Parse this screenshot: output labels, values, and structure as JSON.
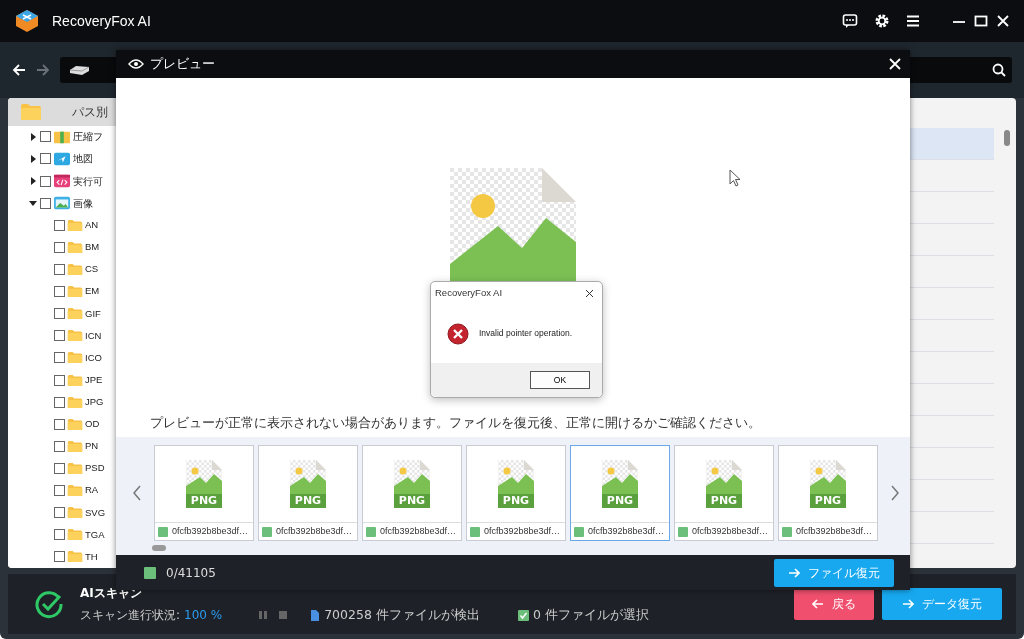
{
  "window": {
    "title": "RecoveryFox AI"
  },
  "sidebar": {
    "header": "パス別",
    "tree": [
      {
        "label": "圧縮フ",
        "kind": "archive",
        "expanded": false,
        "checked": false
      },
      {
        "label": "地図",
        "kind": "map",
        "expanded": false,
        "checked": false
      },
      {
        "label": "実行可",
        "kind": "executable",
        "expanded": false,
        "checked": false
      },
      {
        "label": "画像",
        "kind": "image",
        "expanded": true,
        "checked": false,
        "children": [
          {
            "label": "AN",
            "checked": false
          },
          {
            "label": "BM",
            "checked": false
          },
          {
            "label": "CS",
            "checked": false
          },
          {
            "label": "EM",
            "checked": false
          },
          {
            "label": "GIF",
            "checked": false
          },
          {
            "label": "ICN",
            "checked": false
          },
          {
            "label": "ICO",
            "checked": false
          },
          {
            "label": "JPE",
            "checked": false
          },
          {
            "label": "JPG",
            "checked": false
          },
          {
            "label": "OD",
            "checked": false
          },
          {
            "label": "PN",
            "checked": false
          },
          {
            "label": "PSD",
            "checked": false
          },
          {
            "label": "RA",
            "checked": false
          },
          {
            "label": "SVG",
            "checked": false
          },
          {
            "label": "TGA",
            "checked": false
          },
          {
            "label": "TH",
            "checked": false
          }
        ]
      }
    ]
  },
  "file_list": {
    "rows": [
      {
        "selected": true
      },
      {
        "selected": false
      },
      {
        "selected": false
      },
      {
        "selected": false
      },
      {
        "selected": false
      },
      {
        "selected": false
      },
      {
        "selected": false
      },
      {
        "selected": false
      },
      {
        "selected": false
      },
      {
        "selected": false
      },
      {
        "selected": false
      },
      {
        "selected": false
      },
      {
        "selected": false
      }
    ]
  },
  "preview": {
    "title": "プレビュー",
    "notice": "プレビューが正常に表示されない場合があります。ファイルを復元後、正常に開けるかご確認ください。",
    "thumbnails": [
      {
        "name": "0fcfb392b8be3df…",
        "badge": "PNG",
        "selected": false,
        "checked": false
      },
      {
        "name": "0fcfb392b8be3df…",
        "badge": "PNG",
        "selected": false,
        "checked": false
      },
      {
        "name": "0fcfb392b8be3df…",
        "badge": "PNG",
        "selected": false,
        "checked": false
      },
      {
        "name": "0fcfb392b8be3df…",
        "badge": "PNG",
        "selected": false,
        "checked": false
      },
      {
        "name": "0fcfb392b8be3df…",
        "badge": "PNG",
        "selected": true,
        "checked": false
      },
      {
        "name": "0fcfb392b8be3df…",
        "badge": "PNG",
        "selected": false,
        "checked": false
      },
      {
        "name": "0fcfb392b8be3df…",
        "badge": "PNG",
        "selected": false,
        "checked": false
      }
    ],
    "select_all_checked": false,
    "counter": "0/41105",
    "restore_button": "ファイル復元"
  },
  "error_dialog": {
    "title": "RecoveryFox AI",
    "message": "Invalid pointer operation.",
    "ok_button": "OK"
  },
  "status": {
    "title": "AIスキャン",
    "progress_label": "スキャン進行状況:",
    "progress_value": "100 %",
    "found": "700258 件ファイルが検出",
    "selected_count": "0 件ファイルが選択",
    "back_button": "戻る",
    "recover_button": "データ復元"
  }
}
